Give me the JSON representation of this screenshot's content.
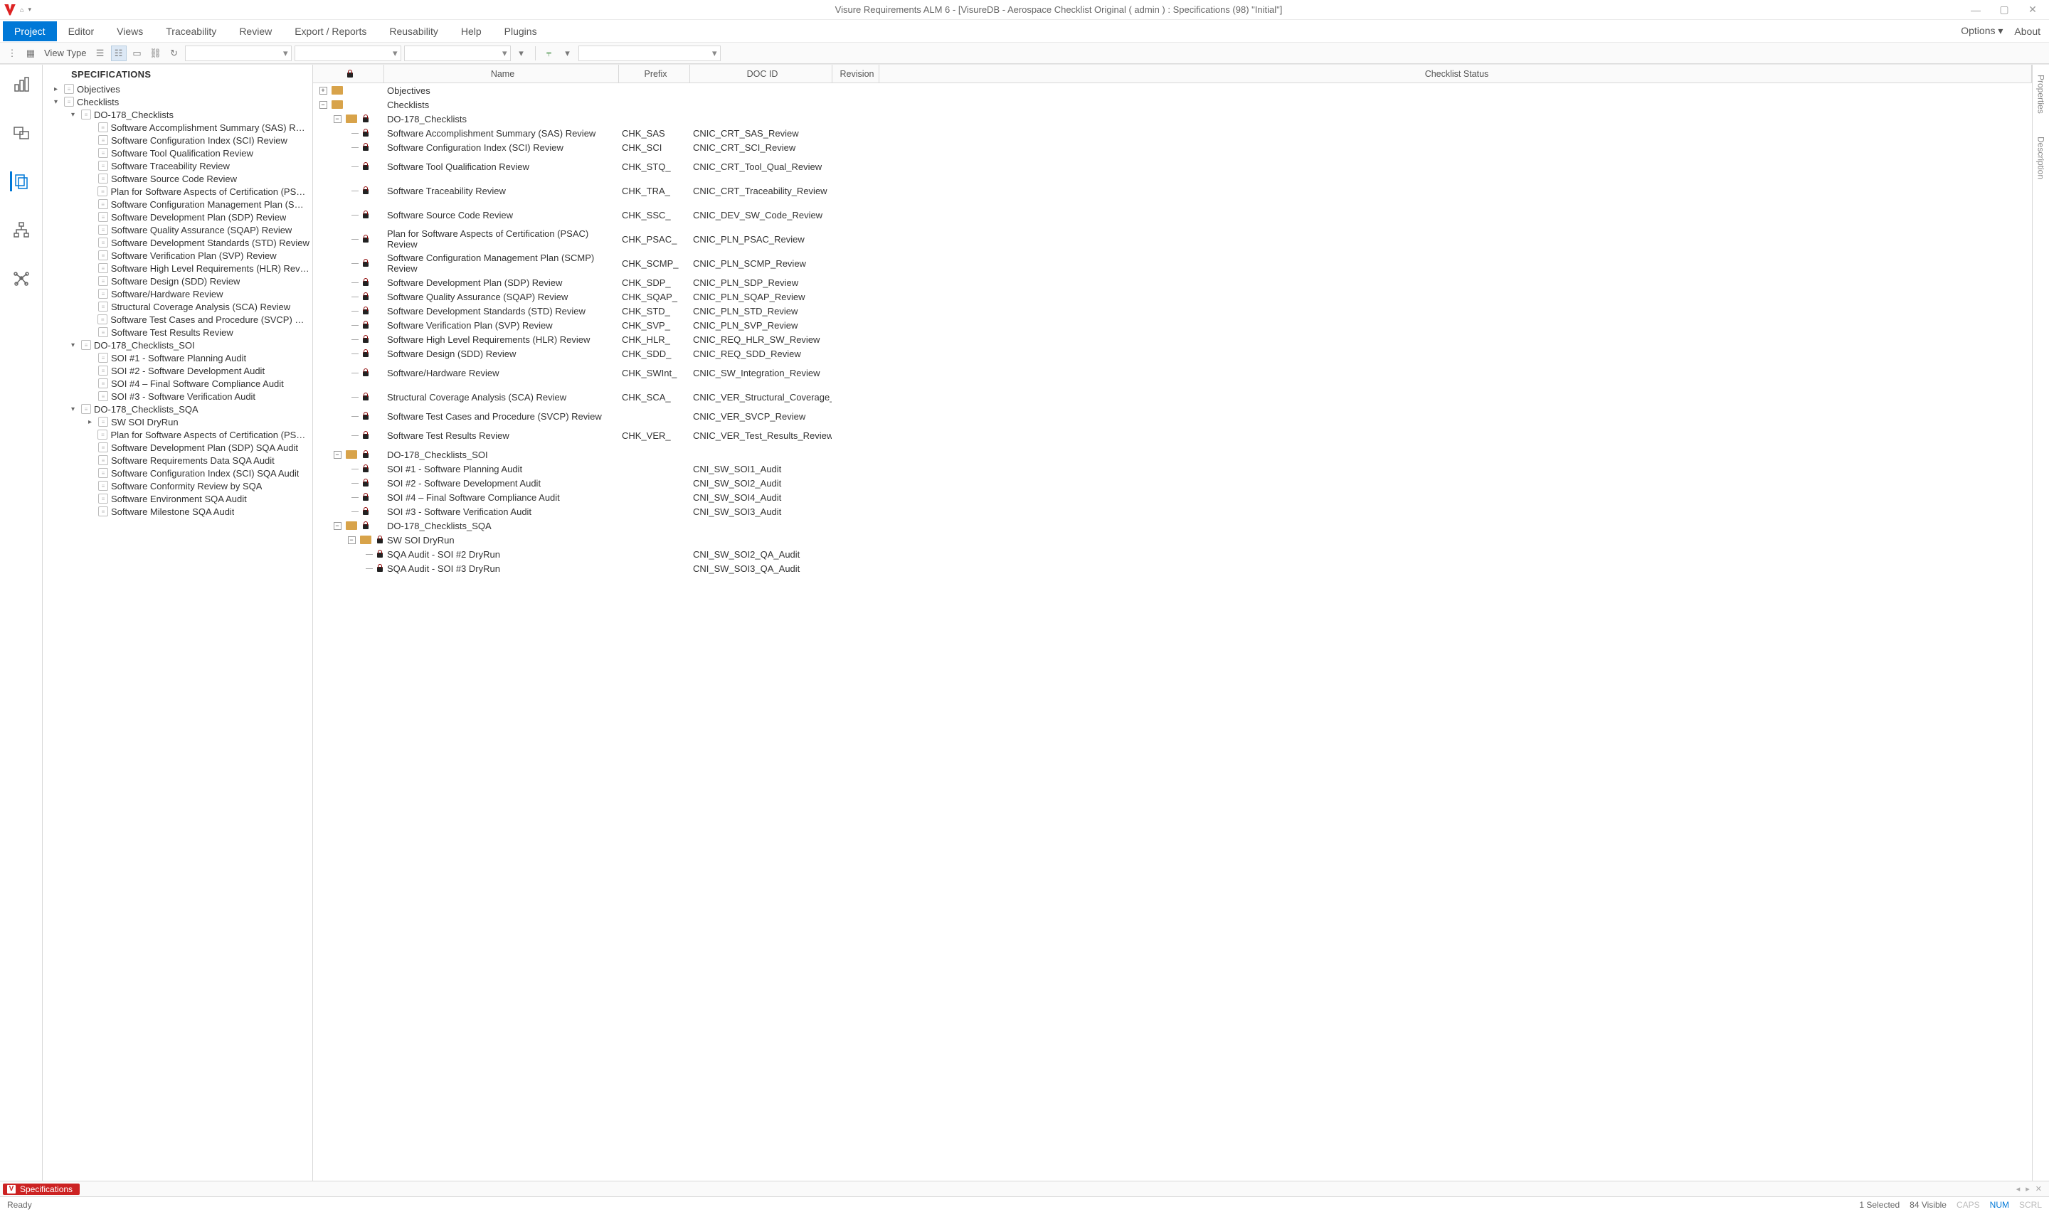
{
  "titlebar": {
    "title": "Visure Requirements ALM 6 - [VisureDB - Aerospace Checklist Original ( admin ) : Specifications (98) \"Initial\"]"
  },
  "menu": {
    "items": [
      "Project",
      "Editor",
      "Views",
      "Traceability",
      "Review",
      "Export / Reports",
      "Reusability",
      "Help",
      "Plugins"
    ],
    "active": "Project",
    "right": [
      {
        "label": "Options",
        "hasDropdown": true
      },
      {
        "label": "About",
        "hasDropdown": false
      }
    ]
  },
  "toolbar": {
    "view_type_label": "View Type"
  },
  "tree": {
    "title": "SPECIFICATIONS",
    "nodes": [
      {
        "depth": 0,
        "chev": ">",
        "label": "Objectives"
      },
      {
        "depth": 0,
        "chev": "v",
        "label": "Checklists"
      },
      {
        "depth": 1,
        "chev": "v",
        "label": "DO-178_Checklists"
      },
      {
        "depth": 2,
        "chev": "",
        "label": "Software Accomplishment Summary (SAS) Review"
      },
      {
        "depth": 2,
        "chev": "",
        "label": "Software Configuration Index (SCI) Review"
      },
      {
        "depth": 2,
        "chev": "",
        "label": "Software Tool Qualification Review"
      },
      {
        "depth": 2,
        "chev": "",
        "label": "Software Traceability Review"
      },
      {
        "depth": 2,
        "chev": "",
        "label": "Software Source Code Review"
      },
      {
        "depth": 2,
        "chev": "",
        "label": "Plan for Software Aspects of Certification (PSAC) R"
      },
      {
        "depth": 2,
        "chev": "",
        "label": "Software Configuration Management Plan (SCMP)"
      },
      {
        "depth": 2,
        "chev": "",
        "label": "Software Development Plan (SDP) Review"
      },
      {
        "depth": 2,
        "chev": "",
        "label": "Software Quality Assurance (SQAP) Review"
      },
      {
        "depth": 2,
        "chev": "",
        "label": "Software Development Standards (STD) Review"
      },
      {
        "depth": 2,
        "chev": "",
        "label": "Software Verification Plan (SVP) Review"
      },
      {
        "depth": 2,
        "chev": "",
        "label": "Software High Level Requirements (HLR) Review"
      },
      {
        "depth": 2,
        "chev": "",
        "label": "Software Design (SDD) Review"
      },
      {
        "depth": 2,
        "chev": "",
        "label": "Software/Hardware Review"
      },
      {
        "depth": 2,
        "chev": "",
        "label": "Structural Coverage Analysis (SCA) Review"
      },
      {
        "depth": 2,
        "chev": "",
        "label": "Software Test Cases and Procedure (SVCP) Review"
      },
      {
        "depth": 2,
        "chev": "",
        "label": "Software Test Results Review"
      },
      {
        "depth": 1,
        "chev": "v",
        "label": "DO-178_Checklists_SOI"
      },
      {
        "depth": 2,
        "chev": "",
        "label": "SOI #1 - Software Planning Audit"
      },
      {
        "depth": 2,
        "chev": "",
        "label": "SOI #2 - Software Development Audit"
      },
      {
        "depth": 2,
        "chev": "",
        "label": "SOI #4 – Final Software Compliance Audit"
      },
      {
        "depth": 2,
        "chev": "",
        "label": "SOI #3 - Software Verification Audit"
      },
      {
        "depth": 1,
        "chev": "v",
        "label": "DO-178_Checklists_SQA"
      },
      {
        "depth": 2,
        "chev": ">",
        "label": "SW SOI DryRun"
      },
      {
        "depth": 2,
        "chev": "",
        "label": "Plan for Software Aspects of Certification (PSAC) S"
      },
      {
        "depth": 2,
        "chev": "",
        "label": "Software Development Plan (SDP) SQA Audit"
      },
      {
        "depth": 2,
        "chev": "",
        "label": "Software Requirements Data SQA Audit"
      },
      {
        "depth": 2,
        "chev": "",
        "label": "Software Configuration Index (SCI) SQA Audit"
      },
      {
        "depth": 2,
        "chev": "",
        "label": "Software Conformity Review by SQA"
      },
      {
        "depth": 2,
        "chev": "",
        "label": "Software Environment SQA Audit"
      },
      {
        "depth": 2,
        "chev": "",
        "label": "Software Milestone SQA Audit"
      }
    ]
  },
  "grid": {
    "columns": [
      "",
      "Name",
      "Prefix",
      "DOC ID",
      "Revision",
      "Checklist Status"
    ],
    "rows": [
      {
        "ttype": "plus-folder",
        "depth": 0,
        "name": "Objectives"
      },
      {
        "ttype": "minus-folder",
        "depth": 0,
        "name": "Checklists"
      },
      {
        "ttype": "minus-folder",
        "depth": 1,
        "lock": true,
        "name": "DO-178_Checklists",
        "tall": false
      },
      {
        "ttype": "leaf",
        "depth": 2,
        "lock": true,
        "name": "Software Accomplishment Summary (SAS) Review",
        "prefix": "CHK_SAS",
        "doc": "CNIC_CRT_SAS_Review"
      },
      {
        "ttype": "leaf",
        "depth": 2,
        "lock": true,
        "name": "Software Configuration Index (SCI) Review",
        "prefix": "CHK_SCI",
        "doc": "CNIC_CRT_SCI_Review"
      },
      {
        "ttype": "leaf",
        "depth": 2,
        "lock": true,
        "name": "Software Tool Qualification Review",
        "prefix": "CHK_STQ_",
        "doc": "CNIC_CRT_Tool_Qual_Review",
        "tall": true
      },
      {
        "ttype": "leaf",
        "depth": 2,
        "lock": true,
        "name": "Software Traceability Review",
        "prefix": "CHK_TRA_",
        "doc": "CNIC_CRT_Traceability_Review",
        "tall": true
      },
      {
        "ttype": "leaf",
        "depth": 2,
        "lock": true,
        "name": "Software Source Code Review",
        "prefix": "CHK_SSC_",
        "doc": "CNIC_DEV_SW_Code_Review",
        "tall": true
      },
      {
        "ttype": "leaf",
        "depth": 2,
        "lock": true,
        "name": "Plan for Software Aspects of Certification (PSAC) Review",
        "prefix": "CHK_PSAC_",
        "doc": "CNIC_PLN_PSAC_Review",
        "tall": true
      },
      {
        "ttype": "leaf",
        "depth": 2,
        "lock": true,
        "name": "Software Configuration Management Plan (SCMP) Review",
        "prefix": "CHK_SCMP_",
        "doc": "CNIC_PLN_SCMP_Review",
        "tall": true
      },
      {
        "ttype": "leaf",
        "depth": 2,
        "lock": true,
        "name": "Software Development Plan (SDP) Review",
        "prefix": "CHK_SDP_",
        "doc": "CNIC_PLN_SDP_Review"
      },
      {
        "ttype": "leaf",
        "depth": 2,
        "lock": true,
        "name": "Software Quality Assurance (SQAP) Review",
        "prefix": "CHK_SQAP_",
        "doc": "CNIC_PLN_SQAP_Review"
      },
      {
        "ttype": "leaf",
        "depth": 2,
        "lock": true,
        "name": "Software Development Standards (STD) Review",
        "prefix": "CHK_STD_",
        "doc": "CNIC_PLN_STD_Review"
      },
      {
        "ttype": "leaf",
        "depth": 2,
        "lock": true,
        "name": "Software Verification Plan (SVP) Review",
        "prefix": "CHK_SVP_",
        "doc": "CNIC_PLN_SVP_Review"
      },
      {
        "ttype": "leaf",
        "depth": 2,
        "lock": true,
        "name": "Software High Level Requirements (HLR) Review",
        "prefix": "CHK_HLR_",
        "doc": "CNIC_REQ_HLR_SW_Review"
      },
      {
        "ttype": "leaf",
        "depth": 2,
        "lock": true,
        "name": "Software Design (SDD) Review",
        "prefix": "CHK_SDD_",
        "doc": "CNIC_REQ_SDD_Review"
      },
      {
        "ttype": "leaf",
        "depth": 2,
        "lock": true,
        "name": "Software/Hardware Review",
        "prefix": "CHK_SWInt_",
        "doc": "CNIC_SW_Integration_Review",
        "tall": true
      },
      {
        "ttype": "leaf",
        "depth": 2,
        "lock": true,
        "name": "Structural Coverage Analysis (SCA) Review",
        "prefix": "CHK_SCA_",
        "doc": "CNIC_VER_Structural_Coverage_Analysis",
        "tall": true
      },
      {
        "ttype": "leaf",
        "depth": 2,
        "lock": true,
        "name": "Software Test Cases and Procedure (SVCP) Review",
        "prefix": "",
        "doc": "CNIC_VER_SVCP_Review"
      },
      {
        "ttype": "leaf-last",
        "depth": 2,
        "lock": true,
        "name": "Software Test Results Review",
        "prefix": "CHK_VER_",
        "doc": "CNIC_VER_Test_Results_Review",
        "tall": true
      },
      {
        "ttype": "minus-folder",
        "depth": 1,
        "lock": true,
        "name": "DO-178_Checklists_SOI"
      },
      {
        "ttype": "leaf",
        "depth": 2,
        "lock": true,
        "name": "SOI #1 - Software Planning Audit",
        "prefix": "",
        "doc": "CNI_SW_SOI1_Audit"
      },
      {
        "ttype": "leaf",
        "depth": 2,
        "lock": true,
        "name": "SOI #2 - Software Development Audit",
        "prefix": "",
        "doc": "CNI_SW_SOI2_Audit"
      },
      {
        "ttype": "leaf",
        "depth": 2,
        "lock": true,
        "name": "SOI #4 – Final Software Compliance Audit",
        "prefix": "",
        "doc": "CNI_SW_SOI4_Audit"
      },
      {
        "ttype": "leaf-last",
        "depth": 2,
        "lock": true,
        "name": "SOI #3 - Software Verification Audit",
        "prefix": "",
        "doc": "CNI_SW_SOI3_Audit"
      },
      {
        "ttype": "minus-folder",
        "depth": 1,
        "lock": true,
        "name": "DO-178_Checklists_SQA"
      },
      {
        "ttype": "minus-folder",
        "depth": 2,
        "lock": true,
        "name": "SW SOI DryRun"
      },
      {
        "ttype": "leaf",
        "depth": 3,
        "lock": true,
        "name": "SQA Audit - SOI #2 DryRun",
        "prefix": "",
        "doc": "CNI_SW_SOI2_QA_Audit"
      },
      {
        "ttype": "leaf",
        "depth": 3,
        "lock": true,
        "name": "SQA Audit - SOI #3 DryRun",
        "prefix": "",
        "doc": "CNI_SW_SOI3_QA_Audit"
      }
    ]
  },
  "right_tabs": [
    "Properties",
    "Description"
  ],
  "doc_tab": {
    "label": "Specifications"
  },
  "status": {
    "left": "Ready",
    "selected": "1 Selected",
    "visible": "84 Visible",
    "caps": "CAPS",
    "num": "NUM",
    "scrl": "SCRL"
  }
}
